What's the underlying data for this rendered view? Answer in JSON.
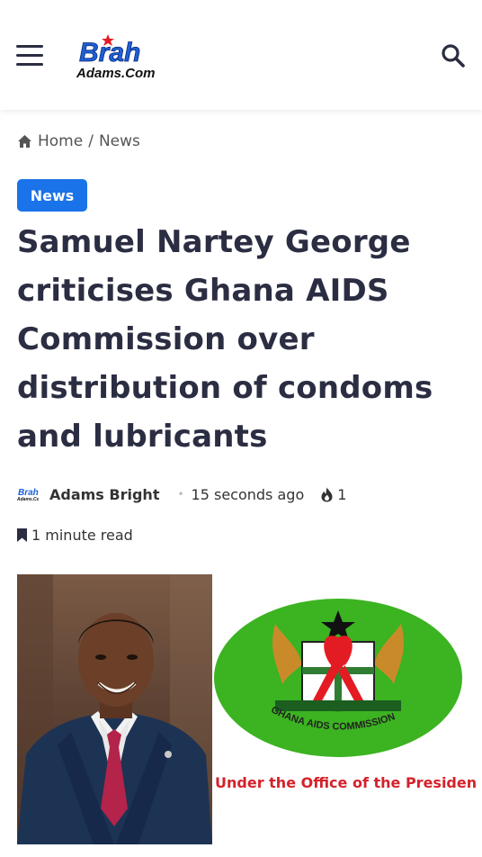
{
  "header": {
    "logo_line1": "Brah",
    "logo_line2": "Adams.Com",
    "menu_icon": "hamburger-menu-icon",
    "search_icon": "search-icon"
  },
  "breadcrumb": {
    "home_label": "Home",
    "separator": "/",
    "current": "News"
  },
  "article": {
    "category": "News",
    "title": "Samuel Nartey George criticises Ghana AIDS Commission over distribution of condoms and lubricants",
    "author": "Adams Bright",
    "time_ago": "15 seconds ago",
    "views": "1",
    "read_time": "1 minute read"
  },
  "featured_image": {
    "emblem_text": "GHANA AIDS COMMISSION",
    "caption_text": "Under  the Office of the Presiden"
  },
  "colors": {
    "accent": "#1a73e8",
    "title": "#2b2d42",
    "emblem_green": "#3cb321",
    "caption_red": "#d4222b"
  }
}
